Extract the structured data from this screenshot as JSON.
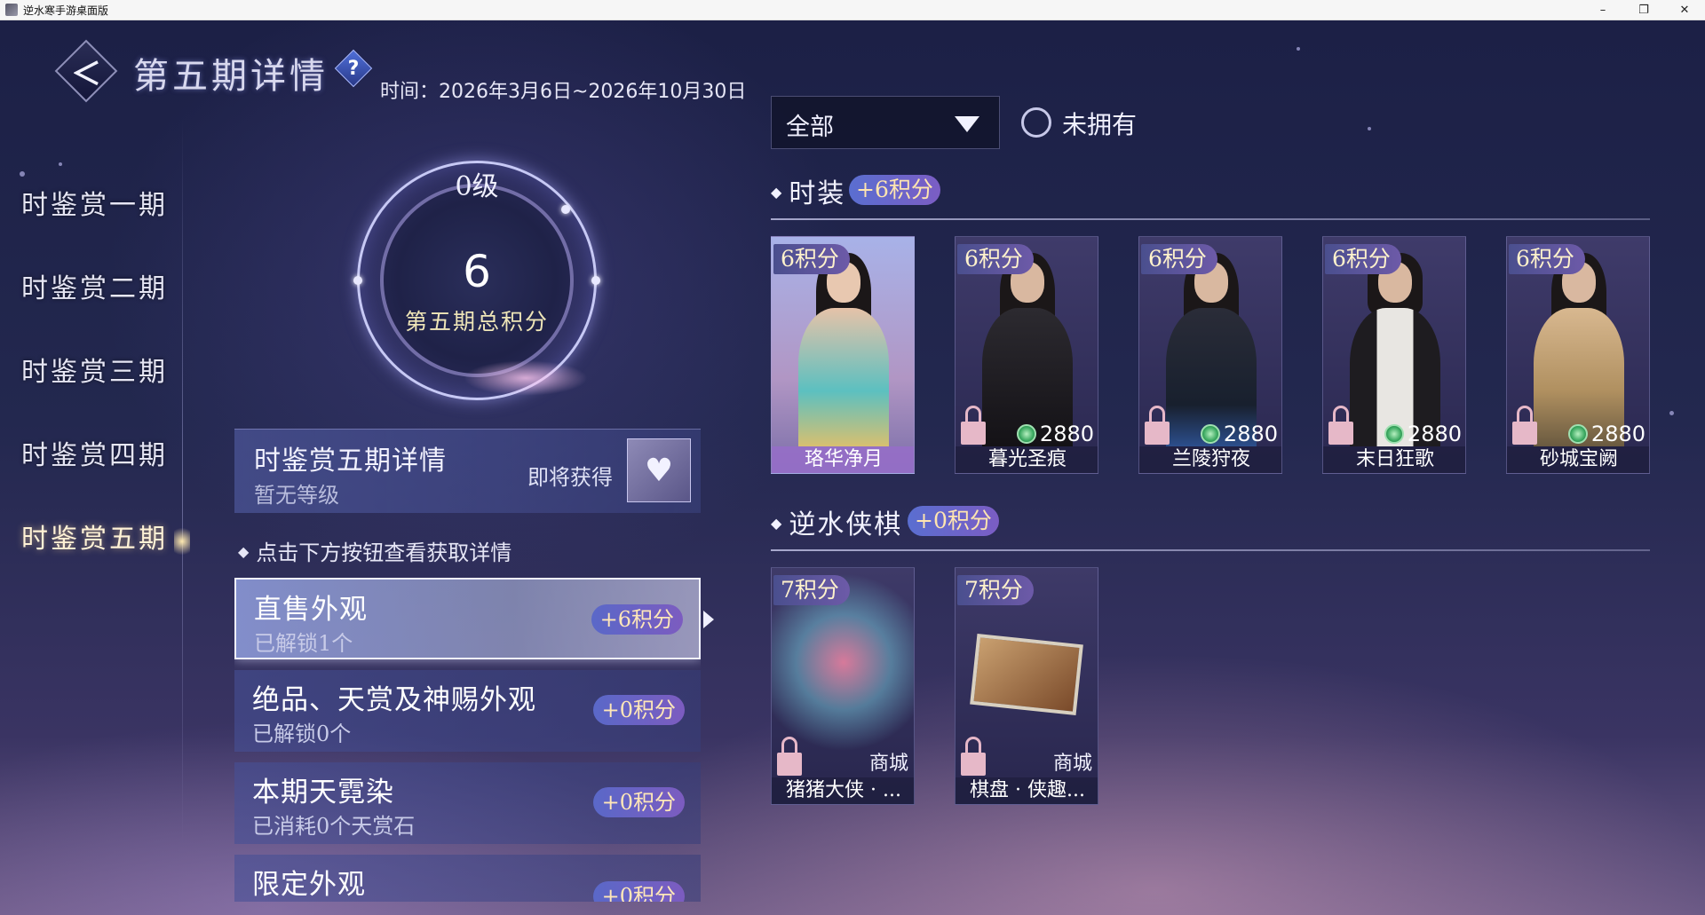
{
  "window": {
    "title": "逆水寒手游桌面版",
    "minimize": "–",
    "restore": "❐",
    "close": "✕"
  },
  "header": {
    "back_glyph": "＜",
    "title": "第五期详情",
    "help_glyph": "?",
    "time": "时间：2026年3月6日~2026年10月30日"
  },
  "nav": {
    "items": [
      {
        "label": "时鉴赏一期",
        "active": false
      },
      {
        "label": "时鉴赏二期",
        "active": false
      },
      {
        "label": "时鉴赏三期",
        "active": false
      },
      {
        "label": "时鉴赏四期",
        "active": false
      },
      {
        "label": "时鉴赏五期",
        "active": true
      }
    ]
  },
  "score": {
    "level": "0级",
    "value": "6",
    "label": "第五期总积分"
  },
  "detail_card": {
    "title": "时鉴赏五期详情",
    "subtitle": "暂无等级",
    "soon_label": "即将获得",
    "reward_icon": "gem-icon"
  },
  "hint": {
    "bullet": "◆",
    "text": "点击下方按钮查看获取详情"
  },
  "categories": [
    {
      "name": "直售外观",
      "status": "已解锁1个",
      "points": "+6积分",
      "active": true
    },
    {
      "name": "绝品、天赏及神赐外观",
      "status": "已解锁0个",
      "points": "+0积分",
      "active": false
    },
    {
      "name": "本期天霓染",
      "status": "已消耗0个天赏石",
      "points": "+0积分",
      "active": false
    },
    {
      "name": "限定外观",
      "status": "",
      "points": "+0积分",
      "active": false
    }
  ],
  "filter": {
    "selected": "全部",
    "unowned_label": "未拥有"
  },
  "sections": [
    {
      "title": "时装",
      "points": "+6积分",
      "items": [
        {
          "badge": "6积分",
          "name": "珞华净月",
          "price": "",
          "shop": "",
          "owned": true
        },
        {
          "badge": "6积分",
          "name": "暮光圣痕",
          "price": "2880",
          "shop": "",
          "owned": false
        },
        {
          "badge": "6积分",
          "name": "兰陵狩夜",
          "price": "2880",
          "shop": "",
          "owned": false
        },
        {
          "badge": "6积分",
          "name": "末日狂歌",
          "price": "2880",
          "shop": "",
          "owned": false
        },
        {
          "badge": "6积分",
          "name": "砂城宝阙",
          "price": "2880",
          "shop": "",
          "owned": false
        }
      ]
    },
    {
      "title": "逆水侠棋",
      "points": "+0积分",
      "items": [
        {
          "badge": "7积分",
          "name": "猪猪大侠 · ...",
          "price": "",
          "shop": "商城",
          "owned": false
        },
        {
          "badge": "7积分",
          "name": "棋盘 · 侠趣...",
          "price": "",
          "shop": "商城",
          "owned": false
        }
      ]
    }
  ],
  "colors": {
    "accent_points": "#ffe5b0",
    "badge_bg": "#5a6ed0",
    "lock": "#e6b8c8",
    "coin": "#3aa860"
  }
}
